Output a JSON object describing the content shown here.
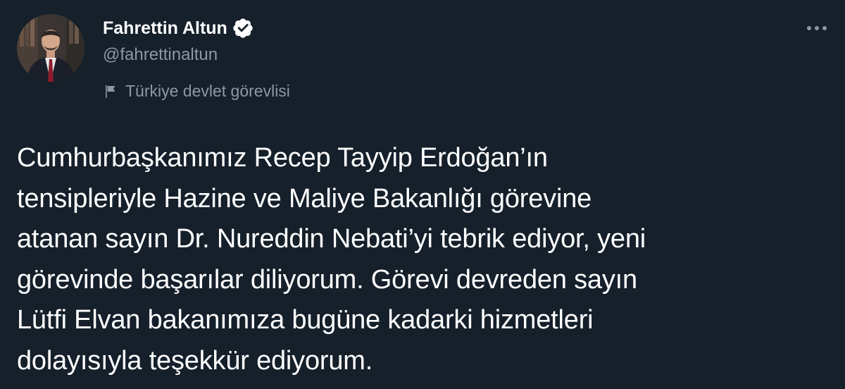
{
  "author": {
    "display_name": "Fahrettin Altun",
    "handle": "@fahrettinaltun",
    "verified": true,
    "account_label": "Türkiye devlet görevlisi"
  },
  "icons": {
    "verified": "verified-badge-icon",
    "label": "flag-icon",
    "more": "more-dots-icon"
  },
  "tweet": {
    "lines": [
      "Cumhurbaşkanımız Recep Tayyip Erdoğan’ın",
      "tensipleriyle Hazine ve Maliye Bakanlığı görevine",
      "atanan sayın Dr. Nureddin Nebati’yi tebrik ediyor, yeni",
      "görevinde başarılar diliyorum. Görevi devreden sayın",
      "Lütfi Elvan bakanımıza bugüne kadarki hizmetleri",
      "dolayısıyla teşekkür ediyorum."
    ]
  },
  "colors": {
    "background": "#15202b",
    "text_primary": "#ffffff",
    "text_secondary": "#8b98a5"
  }
}
